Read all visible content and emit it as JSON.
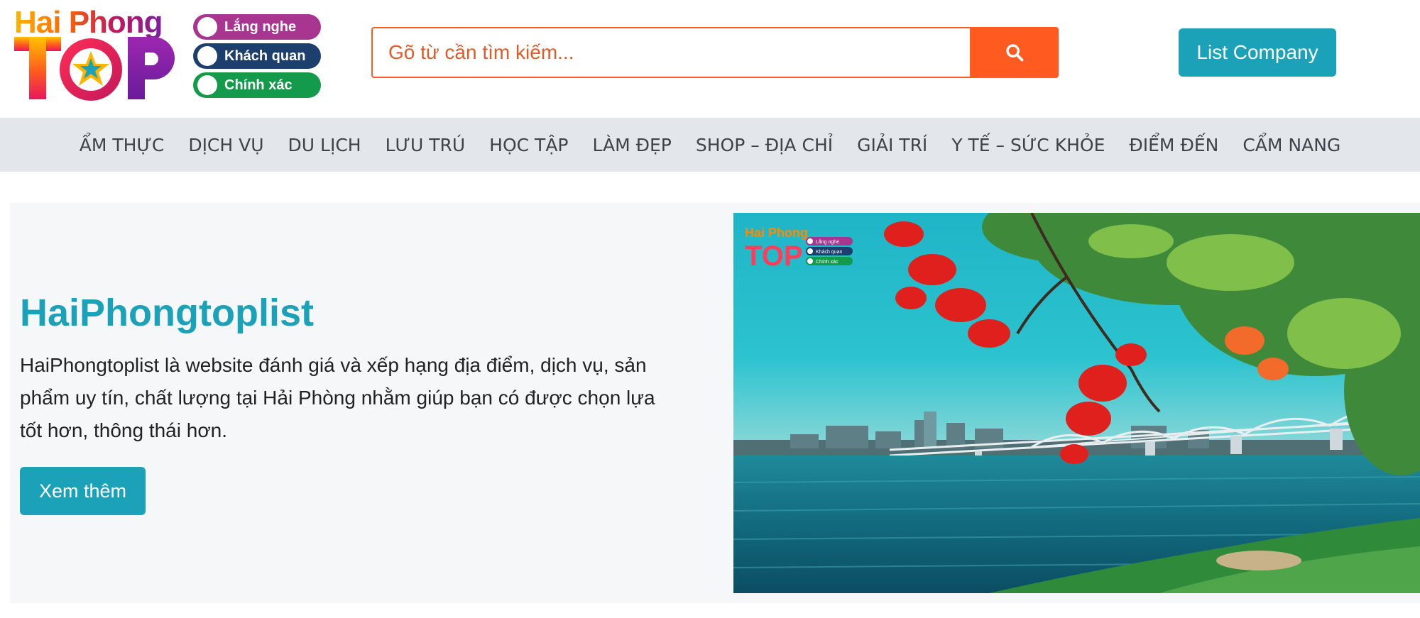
{
  "header": {
    "logo": {
      "top_text": "Hai Phong",
      "main_text": "TOP",
      "pills": [
        "Lắng nghe",
        "Khách quan",
        "Chính xác"
      ]
    },
    "search": {
      "placeholder": "Gõ từ cần tìm kiếm...",
      "button_icon": "search-icon"
    },
    "list_company_label": "List Company"
  },
  "nav": {
    "items": [
      "ẨM THỰC",
      "DỊCH VỤ",
      "DU LỊCH",
      "LƯU TRÚ",
      "HỌC TẬP",
      "LÀM ĐẸP",
      "SHOP – ĐỊA CHỈ",
      "GIẢI TRÍ",
      "Y TẾ – SỨC KHỎE",
      "ĐIỂM ĐẾN",
      "CẨM NANG"
    ]
  },
  "hero": {
    "title": "HaiPhongtoplist",
    "description": "HaiPhongtoplist là website đánh giá và xếp hạng địa điểm, dịch vụ, sản phẩm uy tín, chất lượng tại Hải Phòng nhằm giúp bạn có được chọn lựa tốt hơn, thông thái hơn.",
    "button_label": "Xem thêm",
    "image": {
      "logo_top_text": "Hai Phong",
      "logo_main_text": "TOP",
      "logo_pills": [
        "Lắng nghe",
        "Khách quan",
        "Chính xác"
      ]
    }
  },
  "colors": {
    "accent": "#1ba2b8",
    "search": "#ff5a1f",
    "nav_bg": "#e3e6ea"
  }
}
